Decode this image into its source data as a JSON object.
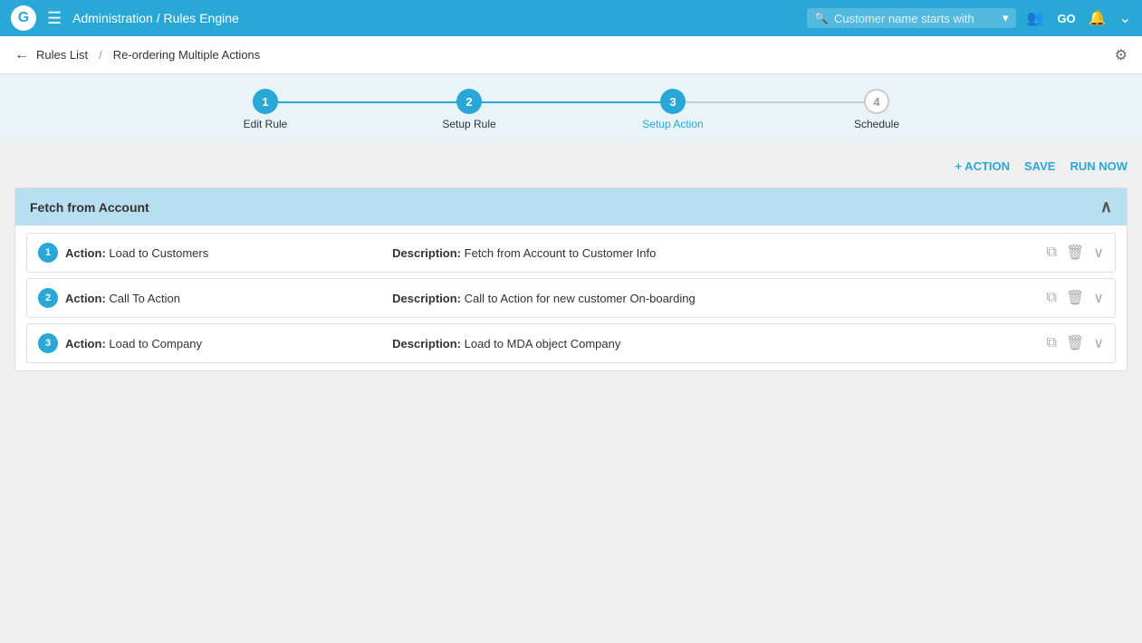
{
  "topNav": {
    "logo": "G",
    "hamburger": "☰",
    "breadcrumb": "Administration / Rules Engine",
    "searchPlaceholder": "Customer name starts with",
    "navIcons": {
      "users": "👥",
      "go": "GO",
      "bell": "🔔",
      "chevron": "⌄"
    }
  },
  "breadcrumbBar": {
    "back": "←",
    "rules_list": "Rules List",
    "separator": "/",
    "page_title": "Re-ordering Multiple Actions"
  },
  "stepper": {
    "steps": [
      {
        "num": "1",
        "label": "Edit Rule",
        "state": "active"
      },
      {
        "num": "2",
        "label": "Setup Rule",
        "state": "active"
      },
      {
        "num": "3",
        "label": "Setup Action",
        "state": "active-current"
      },
      {
        "num": "4",
        "label": "Schedule",
        "state": "inactive"
      }
    ]
  },
  "toolbar": {
    "add_action": "+ ACTION",
    "save": "SAVE",
    "run_now": "RUN NOW"
  },
  "card": {
    "header_title": "Fetch from Account",
    "actions": [
      {
        "num": "1",
        "action_label": "Action:",
        "action_value": "Load to Customers",
        "desc_label": "Description:",
        "desc_value": "Fetch from Account to Customer Info"
      },
      {
        "num": "2",
        "action_label": "Action:",
        "action_value": "Call To Action",
        "desc_label": "Description:",
        "desc_value": "Call to Action for new customer On-boarding"
      },
      {
        "num": "3",
        "action_label": "Action:",
        "action_value": "Load to Company",
        "desc_label": "Description:",
        "desc_value": "Load to MDA object Company"
      }
    ]
  }
}
